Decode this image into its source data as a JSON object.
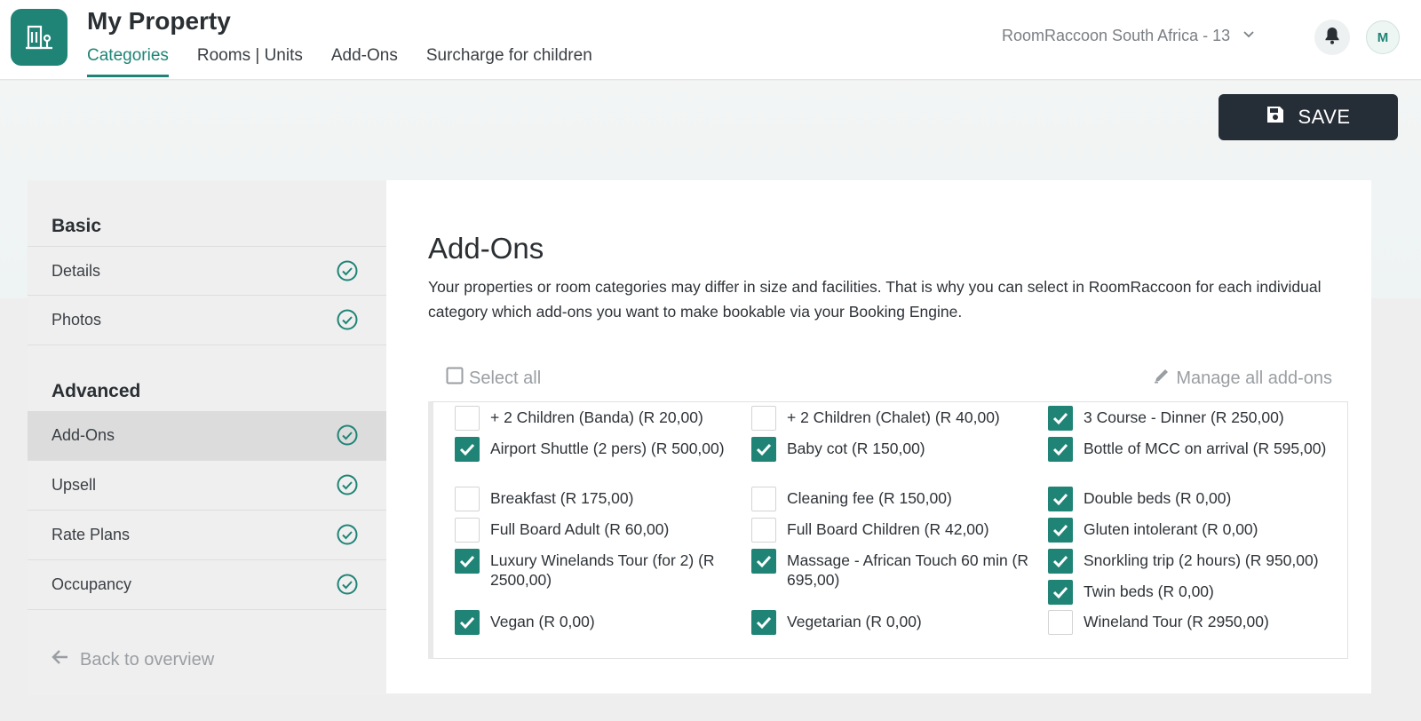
{
  "header": {
    "title": "My Property",
    "tabs": [
      {
        "label": "Categories",
        "active": true
      },
      {
        "label": "Rooms | Units",
        "active": false
      },
      {
        "label": "Add-Ons",
        "active": false
      },
      {
        "label": "Surcharge for children",
        "active": false
      }
    ],
    "org_selector": "RoomRaccoon South Africa - 13",
    "avatar_initial": "M"
  },
  "toolbar": {
    "save_label": "SAVE"
  },
  "sidebar": {
    "basic_heading": "Basic",
    "basic_items": [
      {
        "label": "Details",
        "complete": true
      },
      {
        "label": "Photos",
        "complete": true
      }
    ],
    "advanced_heading": "Advanced",
    "advanced_items": [
      {
        "label": "Add-Ons",
        "complete": true,
        "active": true
      },
      {
        "label": "Upsell",
        "complete": true
      },
      {
        "label": "Rate Plans",
        "complete": true
      },
      {
        "label": "Occupancy",
        "complete": true
      }
    ],
    "back_label": "Back to overview"
  },
  "main": {
    "title": "Add-Ons",
    "description": "Your properties or room categories may differ in size and facilities. That is why you can select in RoomRaccoon for each individual category which add-ons you want to make bookable via your Booking Engine.",
    "select_all_label": "Select all",
    "manage_label": "Manage all add-ons",
    "addons": [
      {
        "label": "+ 2 Children (Banda) (R 20,00)",
        "checked": false
      },
      {
        "label": "+ 2 Children (Chalet) (R 40,00)",
        "checked": false
      },
      {
        "label": "3 Course - Dinner (R 250,00)",
        "checked": true
      },
      {
        "label": "Airport Shuttle (2 pers) (R 500,00)",
        "checked": true
      },
      {
        "label": "Baby cot (R 150,00)",
        "checked": true
      },
      {
        "label": "Bottle of MCC on arrival (R 595,00)",
        "checked": true
      },
      {
        "label": "Breakfast (R 175,00)",
        "checked": false
      },
      {
        "label": "Cleaning fee (R 150,00)",
        "checked": false
      },
      {
        "label": "Double beds (R 0,00)",
        "checked": true
      },
      {
        "label": "Full Board Adult (R 60,00)",
        "checked": false
      },
      {
        "label": "Full Board Children (R 42,00)",
        "checked": false
      },
      {
        "label": "Gluten intolerant (R 0,00)",
        "checked": true
      },
      {
        "label": "Luxury Winelands Tour (for 2) (R 2500,00)",
        "checked": true
      },
      {
        "label": "Massage - African Touch 60 min (R 695,00)",
        "checked": true
      },
      {
        "label": "Snorkling trip (2 hours) (R 950,00)",
        "checked": true
      },
      {
        "label": "Twin beds (R 0,00)",
        "checked": true
      },
      {
        "label": "Vegan (R 0,00)",
        "checked": true
      },
      {
        "label": "Vegetarian (R 0,00)",
        "checked": true
      },
      {
        "label": "Wineland Tour (R 2950,00)",
        "checked": false
      }
    ]
  },
  "colors": {
    "accent": "#1f8476",
    "save_button": "#252d36"
  }
}
